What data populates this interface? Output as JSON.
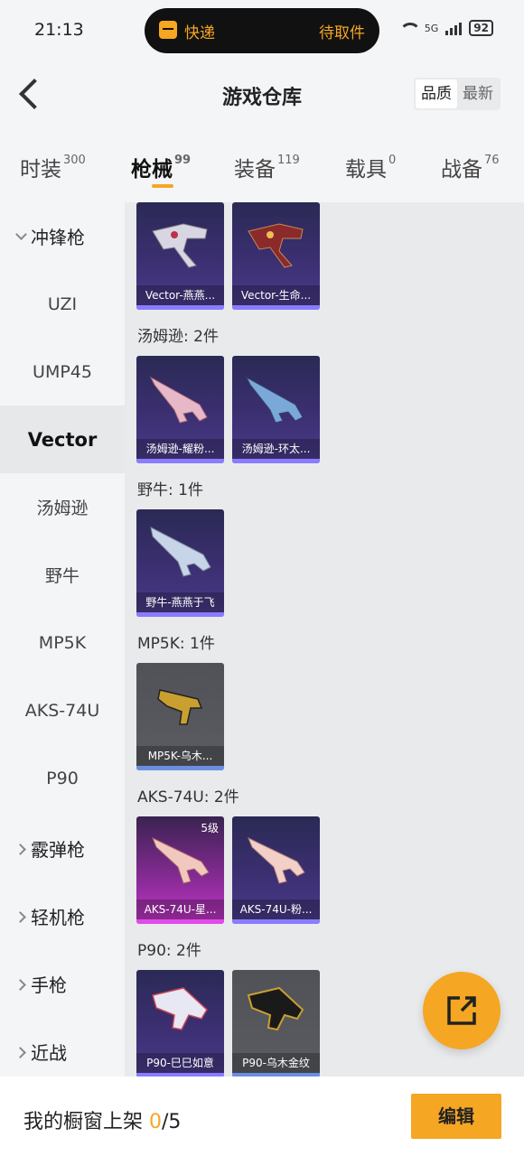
{
  "status_bar": {
    "time": "21:13",
    "pill_left": "快递",
    "pill_right": "待取件",
    "network": "5G",
    "battery": "92"
  },
  "header": {
    "title": "游戏仓库",
    "sort_options": [
      "品质",
      "最新"
    ],
    "sort_selected": "品质"
  },
  "tabs": [
    {
      "label": "时装",
      "count": "300"
    },
    {
      "label": "枪械",
      "count": "99"
    },
    {
      "label": "装备",
      "count": "119"
    },
    {
      "label": "载具",
      "count": "0"
    },
    {
      "label": "战备",
      "count": "76"
    }
  ],
  "active_tab": "枪械",
  "sidebar": {
    "groups": [
      {
        "label": "冲锋枪",
        "expanded": true
      },
      {
        "label": "霰弹枪",
        "expanded": false
      },
      {
        "label": "轻机枪",
        "expanded": false
      },
      {
        "label": "手枪",
        "expanded": false
      },
      {
        "label": "近战",
        "expanded": false
      }
    ],
    "items": [
      "UZI",
      "UMP45",
      "Vector",
      "汤姆逊",
      "野牛",
      "MP5K",
      "AKS-74U",
      "P90"
    ],
    "active_item": "Vector"
  },
  "sections": [
    {
      "label": "",
      "items": [
        {
          "name": "Vector-燕燕...",
          "rarity": "purple",
          "level": ""
        },
        {
          "name": "Vector-生命...",
          "rarity": "purple",
          "level": ""
        }
      ]
    },
    {
      "label": "汤姆逊: 2件",
      "items": [
        {
          "name": "汤姆逊-耀粉...",
          "rarity": "purple",
          "level": ""
        },
        {
          "name": "汤姆逊-环太...",
          "rarity": "purple",
          "level": ""
        }
      ]
    },
    {
      "label": "野牛: 1件",
      "items": [
        {
          "name": "野牛-燕燕于飞",
          "rarity": "purple",
          "level": ""
        }
      ]
    },
    {
      "label": "MP5K: 1件",
      "items": [
        {
          "name": "MP5K-乌木...",
          "rarity": "grey",
          "level": ""
        }
      ]
    },
    {
      "label": "AKS-74U: 2件",
      "items": [
        {
          "name": "AKS-74U-星...",
          "rarity": "pink",
          "level": "5级"
        },
        {
          "name": "AKS-74U-粉...",
          "rarity": "purple",
          "level": ""
        }
      ]
    },
    {
      "label": "P90: 2件",
      "items": [
        {
          "name": "P90-巳巳如意",
          "rarity": "purple",
          "level": ""
        },
        {
          "name": "P90-乌木金纹",
          "rarity": "grey",
          "level": ""
        }
      ]
    }
  ],
  "footer": {
    "label_prefix": "我的橱窗上架 ",
    "shelved": "0",
    "total": "/5",
    "edit_label": "编辑"
  },
  "colors": {
    "accent": "#f5a623",
    "purple_card": "#3c2f72",
    "grey_card": "#55575d",
    "pink_card": "#c036c6"
  },
  "icons": [
    "back-chevron-icon",
    "package-icon",
    "wifi-icon",
    "signal-icon",
    "battery-icon",
    "share-external-icon",
    "gun-icon"
  ]
}
